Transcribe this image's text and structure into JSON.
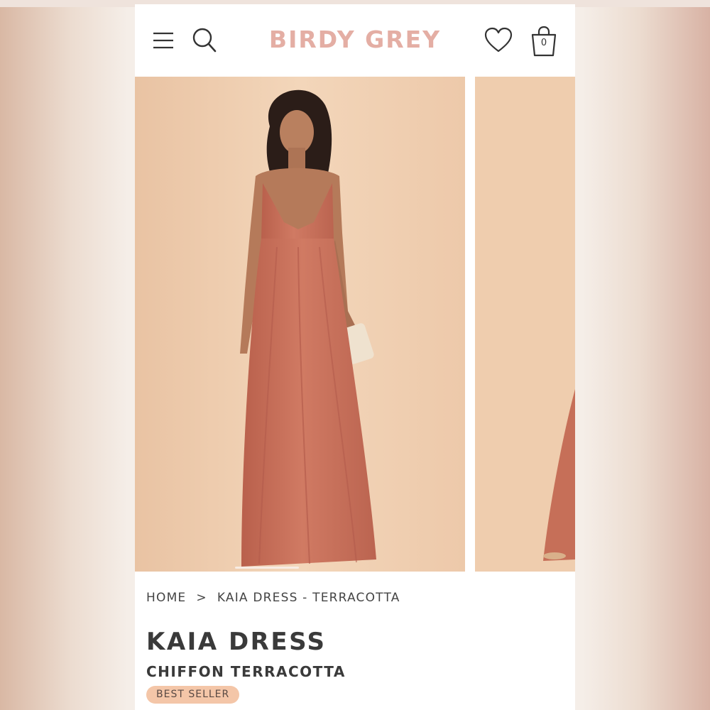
{
  "header": {
    "logo": "BIRDY GREY",
    "menu_icon": "hamburger-menu-icon",
    "search_icon": "search-icon",
    "wishlist_icon": "heart-icon",
    "bag_icon": "shopping-bag-icon",
    "bag_count": "0"
  },
  "gallery": {
    "images": [
      {
        "alt": "Model wearing Kaia Dress in chiffon terracotta, front view"
      },
      {
        "alt": "Kaia Dress terracotta, next image"
      }
    ],
    "active_index": 0,
    "colors": {
      "background": "#f0cfb0",
      "dress": "#c9705a"
    }
  },
  "breadcrumb": {
    "home": "HOME",
    "separator": ">",
    "current": "KAIA DRESS - TERRACOTTA"
  },
  "product": {
    "title": "KAIA DRESS",
    "subtitle": "CHIFFON TERRACOTTA",
    "badge": "BEST SELLER"
  },
  "colors": {
    "logo": "#e4aea4",
    "badge_bg": "#f4c6a8",
    "text": "#3a3a3a"
  }
}
